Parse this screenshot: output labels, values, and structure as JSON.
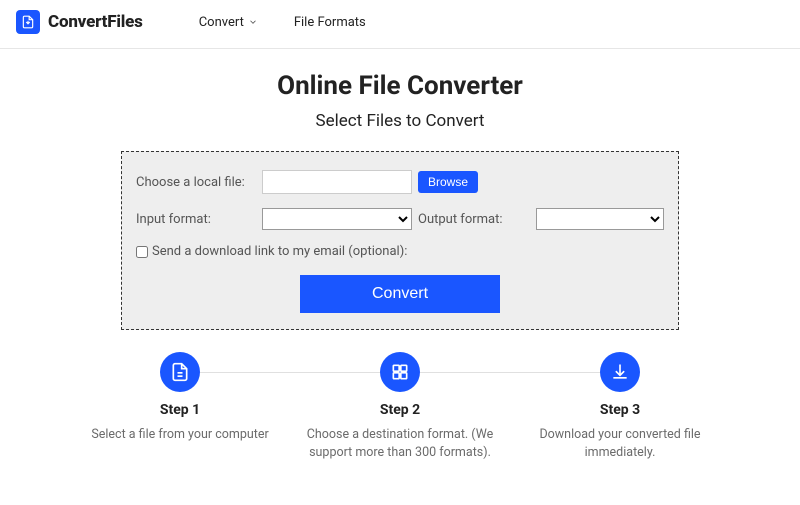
{
  "header": {
    "brand": "ConvertFiles",
    "nav": {
      "convert": "Convert",
      "formats": "File Formats"
    }
  },
  "hero": {
    "title": "Online File Converter",
    "subtitle": "Select Files to Convert"
  },
  "panel": {
    "choose_label": "Choose a local file:",
    "file_value": "",
    "browse": "Browse",
    "input_format_label": "Input format:",
    "output_format_label": "Output format:",
    "email_label": "Send a download link to my email (optional):",
    "convert": "Convert"
  },
  "steps": [
    {
      "title": "Step 1",
      "desc": "Select a file from your computer"
    },
    {
      "title": "Step 2",
      "desc": "Choose a destination format. (We support more than 300 formats)."
    },
    {
      "title": "Step 3",
      "desc": "Download your converted file immediately."
    }
  ]
}
